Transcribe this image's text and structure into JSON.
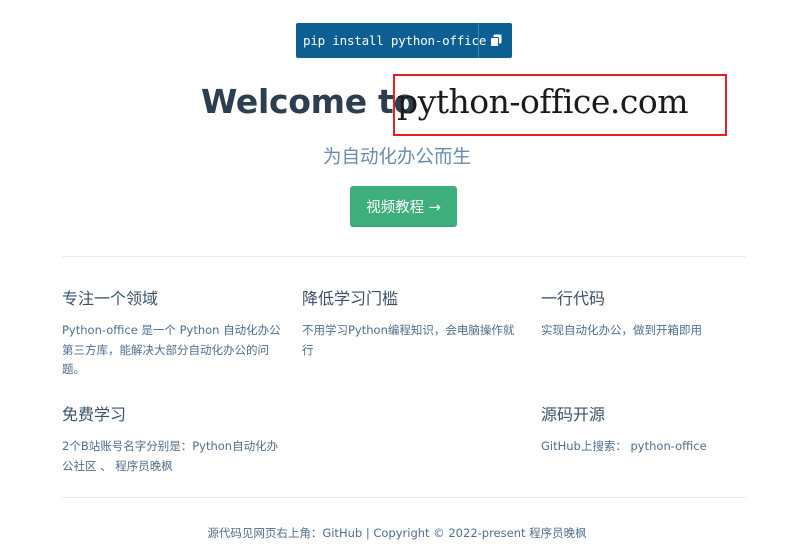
{
  "install": {
    "command": "pip install python-office",
    "copy_icon": "copy-icon"
  },
  "hero": {
    "title_prefix": "Welcome to",
    "title_site": "python-office.com",
    "tagline": "为自动化办公而生",
    "cta_label": "视频教程 →",
    "highlight_color": "#e62020"
  },
  "features": [
    {
      "title": "专注一个领域",
      "details": "Python-office 是一个 Python 自动化办公第三方库，能解决大部分自动化办公的问题。"
    },
    {
      "title": "降低学习门槛",
      "details": "不用学习Python编程知识，会电脑操作就行"
    },
    {
      "title": "一行代码",
      "details": "实现自动化办公，做到开箱即用"
    },
    {
      "title": "免费学习",
      "details": "2个B站账号名字分别是：Python自动化办公社区 、 程序员晚枫"
    },
    {
      "title": "源码开源",
      "details": "GitHub上搜索： python-office"
    }
  ],
  "footer": {
    "text": "源代码见网页右上角：GitHub | Copyright © 2022-present 程序员晚枫"
  },
  "colors": {
    "accent": "#3eaf7c",
    "install_bg": "#0d5f93",
    "text": "#2c3e50"
  }
}
